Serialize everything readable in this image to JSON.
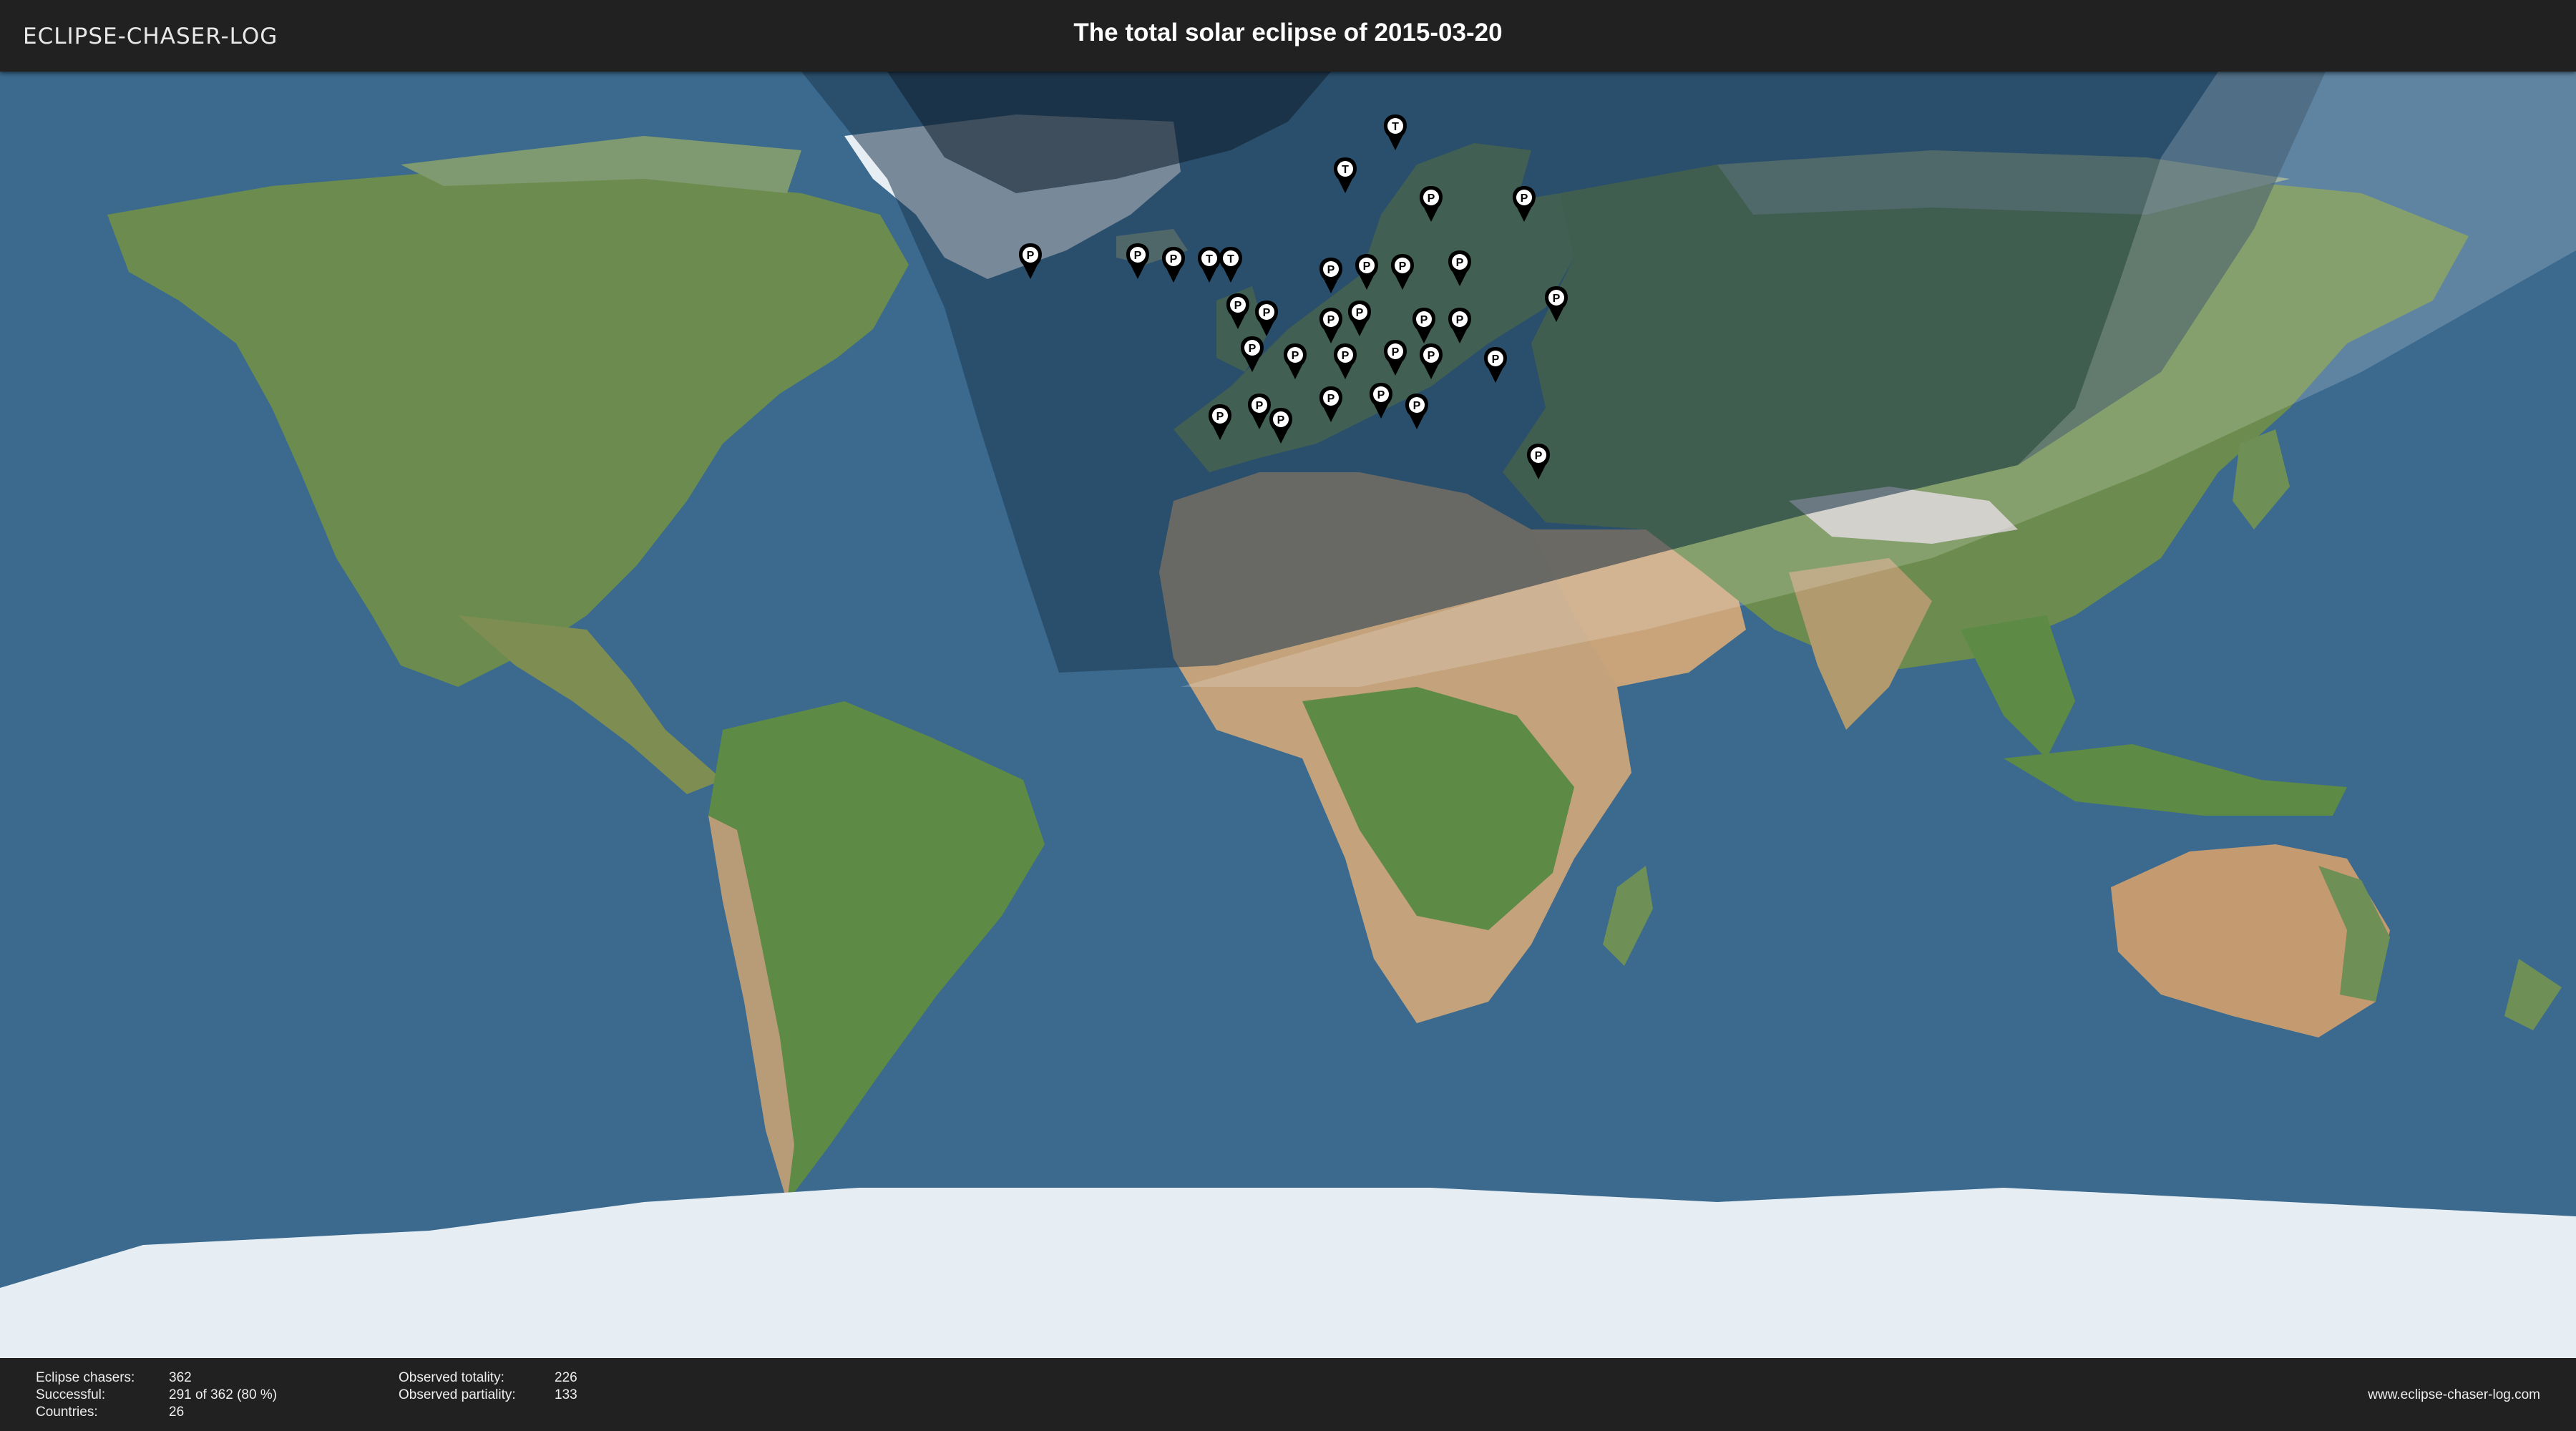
{
  "header": {
    "logo_text": "ECLIPSE-CHASER-LOG",
    "title": "The total solar eclipse of 2015-03-20"
  },
  "map": {
    "ocean_color": "#3b6a8e",
    "land_color": "#6b8c4e",
    "desert_color": "#c3a27c",
    "ice_color": "#e6edf3",
    "partial_zone_color": "#1e3850",
    "totality_zone_color": "#0e1e2c",
    "twilight_color": "#ffffff",
    "marker_color": "#000000",
    "marker_labels": {
      "totality": "T",
      "partiality": "P"
    }
  },
  "stats": {
    "eclipse_chasers_label": "Eclipse chasers:",
    "eclipse_chasers_value": "362",
    "successful_label": "Successful:",
    "successful_value": "291 of 362 (80 %)",
    "countries_label": "Countries:",
    "countries_value": "26",
    "observed_totality_label": "Observed totality:",
    "observed_totality_value": "226",
    "observed_partiality_label": "Observed partiality:",
    "observed_partiality_value": "133"
  },
  "footer": {
    "website": "www.eclipse-chaser-log.com"
  }
}
